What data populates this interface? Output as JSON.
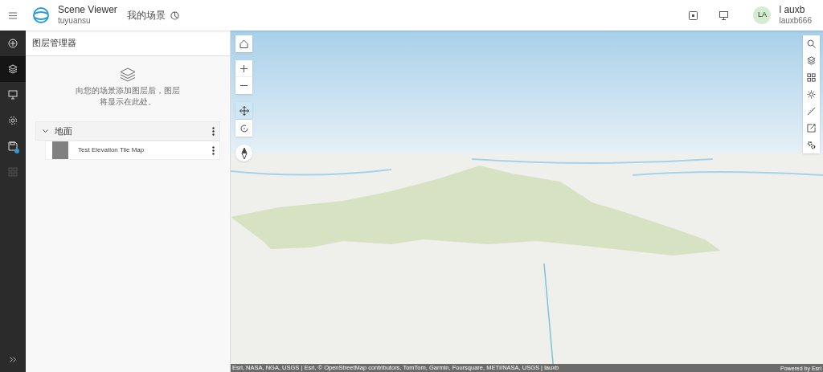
{
  "header": {
    "app_title": "Scene Viewer",
    "app_subtitle": "tuyuansu",
    "scene_link": "我的场景",
    "user_initials": "LA",
    "user_name": "l auxb",
    "user_id": "lauxb666"
  },
  "rail": [
    {
      "kind": "add",
      "selected": false,
      "disabled": false,
      "notification": false
    },
    {
      "kind": "layers",
      "selected": true,
      "disabled": false,
      "notification": false
    },
    {
      "kind": "present",
      "selected": false,
      "disabled": false,
      "notification": false
    },
    {
      "kind": "settings",
      "selected": false,
      "disabled": false,
      "notification": false
    },
    {
      "kind": "save",
      "selected": false,
      "disabled": false,
      "notification": true
    },
    {
      "kind": "apps",
      "selected": false,
      "disabled": true,
      "notification": false
    }
  ],
  "panel": {
    "title": "图层管理器",
    "empty_message": "向您的场景添加图层后，图层将显示在此处。",
    "groups": [
      {
        "label": "地面",
        "expanded": true,
        "children": [
          {
            "label": "Test Elevation Tile Map"
          }
        ]
      }
    ]
  },
  "map": {
    "nav_modes": [
      {
        "kind": "pan",
        "selected": true
      },
      {
        "kind": "rotate",
        "selected": false
      }
    ],
    "right_tools": [
      {
        "kind": "search"
      },
      {
        "kind": "layers"
      },
      {
        "kind": "basemap"
      },
      {
        "kind": "daylight"
      },
      {
        "kind": "measure"
      },
      {
        "kind": "share"
      },
      {
        "kind": "settings"
      }
    ],
    "attribution": "Esri, NASA, NGA, USGS | Esri, © OpenStreetMap contributors, TomTom, Garmin, Foursquare, METI/NASA, USGS | lauxb",
    "powered_by": "Powered by Esri"
  }
}
